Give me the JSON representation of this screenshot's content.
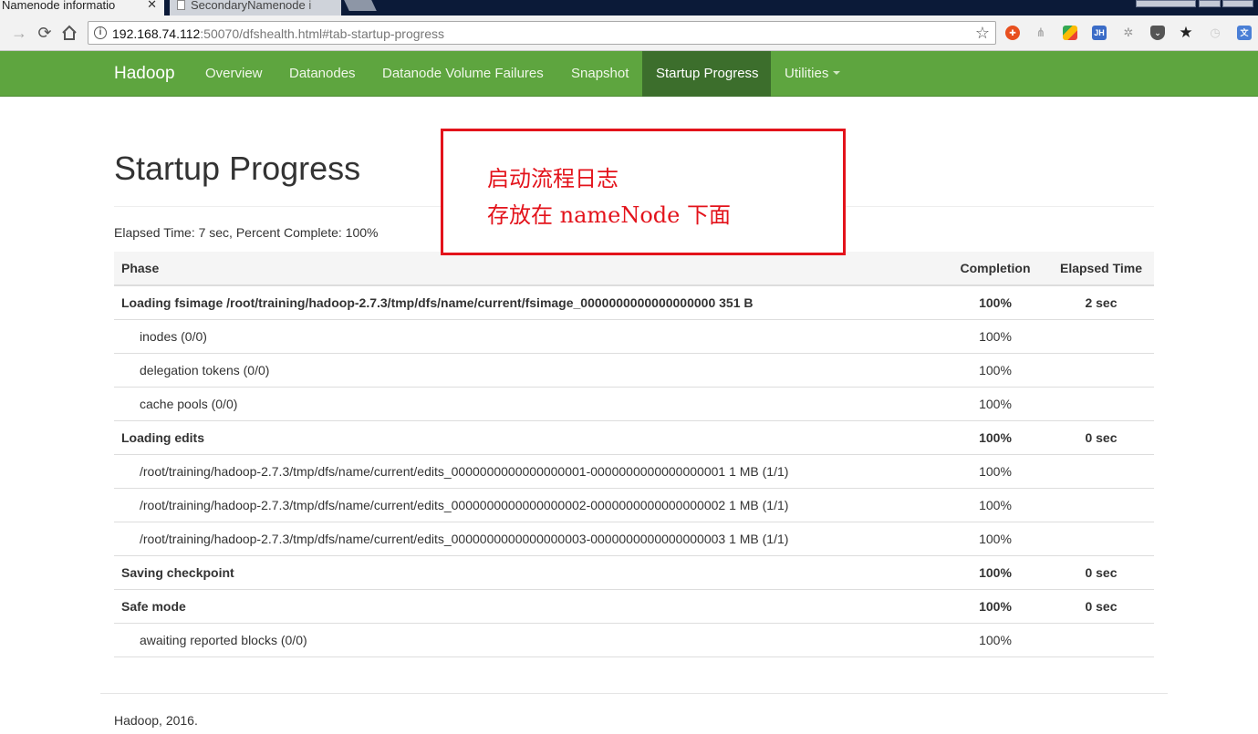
{
  "browser": {
    "tabs": [
      {
        "title": "Namenode informatio",
        "active": true
      },
      {
        "title": "SecondaryNamenode i",
        "active": false
      }
    ],
    "url_host": "192.168.74.112",
    "url_rest": ":50070/dfshealth.html#tab-startup-progress",
    "extension_icons": [
      "ublock-icon",
      "sitemap-icon",
      "color-picker-icon",
      "jh-extension-icon",
      "translate-puzzle-icon",
      "pocket-icon",
      "bookmark-star-icon",
      "clock-icon",
      "google-translate-icon"
    ]
  },
  "navbar": {
    "brand": "Hadoop",
    "items": [
      {
        "label": "Overview",
        "active": false
      },
      {
        "label": "Datanodes",
        "active": false
      },
      {
        "label": "Datanode Volume Failures",
        "active": false
      },
      {
        "label": "Snapshot",
        "active": false
      },
      {
        "label": "Startup Progress",
        "active": true
      },
      {
        "label": "Utilities",
        "active": false,
        "dropdown": true
      }
    ],
    "colors": {
      "bar": "#5ea53f",
      "active": "#3c6e2c"
    }
  },
  "page": {
    "title": "Startup Progress",
    "elapsed_summary": "Elapsed Time: 7 sec, Percent Complete: 100%"
  },
  "annotation": {
    "line1": "启动流程日志",
    "line2": "存放在 nameNode 下面",
    "color": "#e3131b"
  },
  "table": {
    "headers": {
      "phase": "Phase",
      "completion": "Completion",
      "elapsed": "Elapsed Time"
    },
    "rows": [
      {
        "kind": "phase",
        "name": "Loading fsimage /root/training/hadoop-2.7.3/tmp/dfs/name/current/fsimage_0000000000000000000 351 B",
        "completion": "100%",
        "elapsed": "2 sec"
      },
      {
        "kind": "step",
        "name": "inodes (0/0)",
        "completion": "100%",
        "elapsed": ""
      },
      {
        "kind": "step",
        "name": "delegation tokens (0/0)",
        "completion": "100%",
        "elapsed": ""
      },
      {
        "kind": "step",
        "name": "cache pools (0/0)",
        "completion": "100%",
        "elapsed": ""
      },
      {
        "kind": "phase",
        "name": "Loading edits",
        "completion": "100%",
        "elapsed": "0 sec"
      },
      {
        "kind": "step",
        "name": "/root/training/hadoop-2.7.3/tmp/dfs/name/current/edits_0000000000000000001-0000000000000000001 1 MB (1/1)",
        "completion": "100%",
        "elapsed": ""
      },
      {
        "kind": "step",
        "name": "/root/training/hadoop-2.7.3/tmp/dfs/name/current/edits_0000000000000000002-0000000000000000002 1 MB (1/1)",
        "completion": "100%",
        "elapsed": ""
      },
      {
        "kind": "step",
        "name": "/root/training/hadoop-2.7.3/tmp/dfs/name/current/edits_0000000000000000003-0000000000000000003 1 MB (1/1)",
        "completion": "100%",
        "elapsed": ""
      },
      {
        "kind": "phase",
        "name": "Saving checkpoint",
        "completion": "100%",
        "elapsed": "0 sec"
      },
      {
        "kind": "phase",
        "name": "Safe mode",
        "completion": "100%",
        "elapsed": "0 sec"
      },
      {
        "kind": "step",
        "name": "awaiting reported blocks (0/0)",
        "completion": "100%",
        "elapsed": ""
      }
    ]
  },
  "footer": {
    "text": "Hadoop, 2016."
  }
}
